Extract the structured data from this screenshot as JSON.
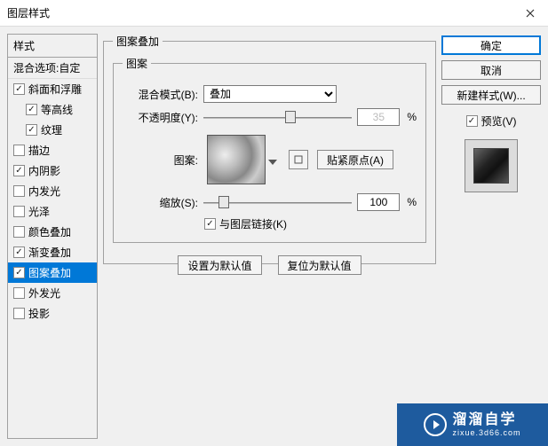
{
  "window": {
    "title": "图层样式"
  },
  "left": {
    "header": "样式",
    "sub": "混合选项:自定",
    "items": [
      {
        "label": "斜面和浮雕",
        "checked": true,
        "indent": false
      },
      {
        "label": "等高线",
        "checked": true,
        "indent": true
      },
      {
        "label": "纹理",
        "checked": true,
        "indent": true
      },
      {
        "label": "描边",
        "checked": false,
        "indent": false
      },
      {
        "label": "内阴影",
        "checked": true,
        "indent": false
      },
      {
        "label": "内发光",
        "checked": false,
        "indent": false
      },
      {
        "label": "光泽",
        "checked": false,
        "indent": false
      },
      {
        "label": "颜色叠加",
        "checked": false,
        "indent": false
      },
      {
        "label": "渐变叠加",
        "checked": true,
        "indent": false
      },
      {
        "label": "图案叠加",
        "checked": true,
        "indent": false,
        "selected": true
      },
      {
        "label": "外发光",
        "checked": false,
        "indent": false
      },
      {
        "label": "投影",
        "checked": false,
        "indent": false
      }
    ]
  },
  "center": {
    "group_title": "图案叠加",
    "inner_title": "图案",
    "blend_label": "混合模式(B):",
    "blend_value": "叠加",
    "opacity_label": "不透明度(Y):",
    "opacity_value": "35",
    "opacity_unit": "%",
    "pattern_label": "图案:",
    "snap_btn": "贴紧原点(A)",
    "scale_label": "缩放(S):",
    "scale_value": "100",
    "scale_unit": "%",
    "link_label": "与图层链接(K)",
    "link_checked": true,
    "default_btn": "设置为默认值",
    "reset_btn": "复位为默认值"
  },
  "right": {
    "ok": "确定",
    "cancel": "取消",
    "new_style": "新建样式(W)...",
    "preview_label": "预览(V)",
    "preview_checked": true
  },
  "watermark": {
    "main": "溜溜自学",
    "sub": "zixue.3d66.com"
  }
}
